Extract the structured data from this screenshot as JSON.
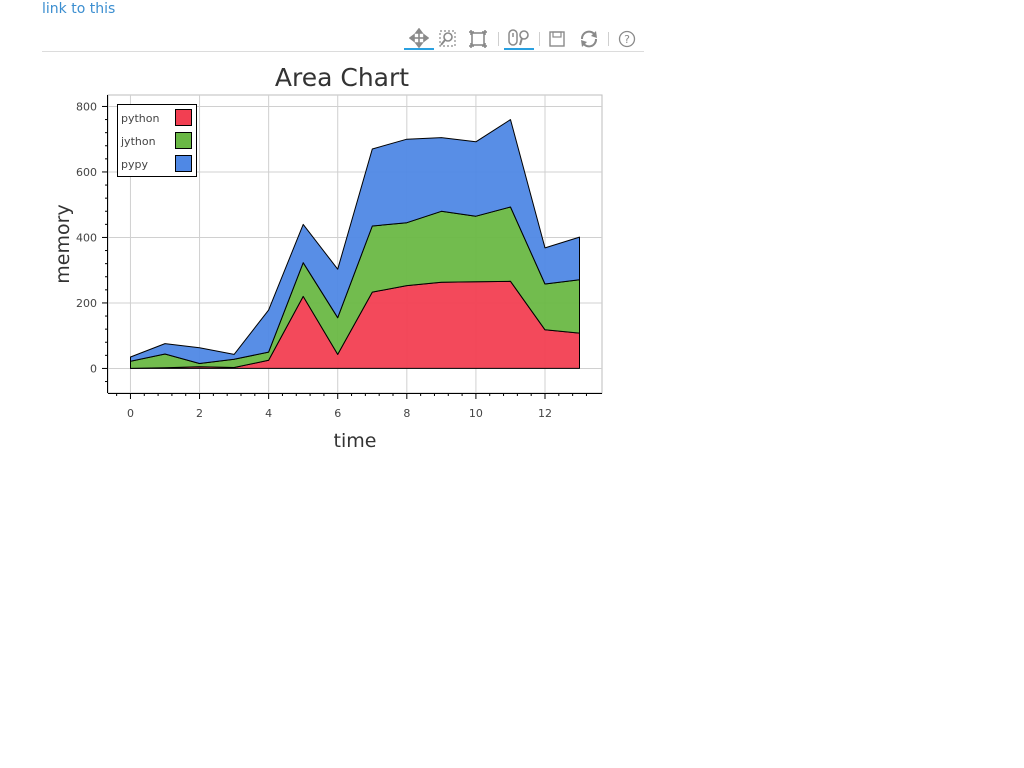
{
  "link": {
    "label": "link to this"
  },
  "toolbar": {
    "tools": [
      {
        "name": "pan-tool",
        "icon": "pan-icon",
        "active": true
      },
      {
        "name": "box-zoom-tool",
        "icon": "box-zoom-icon",
        "active": false
      },
      {
        "name": "resize-tool",
        "icon": "resize-icon",
        "active": false
      },
      {
        "name": "wheel-zoom-tool",
        "icon": "wheel-zoom-icon",
        "active": true
      },
      {
        "name": "save-tool",
        "icon": "save-icon",
        "active": false
      },
      {
        "name": "reset-tool",
        "icon": "reset-icon",
        "active": false
      },
      {
        "name": "help-tool",
        "icon": "help-icon",
        "active": false
      }
    ],
    "accent": "#2aa0e0"
  },
  "chart_data": {
    "type": "area",
    "stacked": true,
    "title": "Area Chart",
    "xlabel": "time",
    "ylabel": "memory",
    "x": [
      0,
      1,
      2,
      3,
      4,
      5,
      6,
      7,
      8,
      9,
      10,
      11,
      12,
      13
    ],
    "xlim": [
      -0.65,
      13.65
    ],
    "ylim": [
      -75,
      835
    ],
    "xticks": [
      0,
      2,
      4,
      6,
      8,
      10,
      12
    ],
    "yticks": [
      0,
      200,
      400,
      600,
      800
    ],
    "grid": true,
    "legend_position": "top-left",
    "series": [
      {
        "name": "python",
        "color": "#f23f52",
        "values": [
          0,
          2,
          5,
          3,
          25,
          220,
          43,
          233,
          253,
          263,
          265,
          266,
          118,
          108
        ]
      },
      {
        "name": "jython",
        "color": "#6ab845",
        "values": [
          22,
          42,
          10,
          25,
          25,
          103,
          112,
          202,
          192,
          217,
          200,
          227,
          140,
          163
        ]
      },
      {
        "name": "pypy",
        "color": "#4f88e5",
        "values": [
          13,
          32,
          48,
          15,
          128,
          117,
          148,
          235,
          255,
          225,
          227,
          267,
          110,
          130
        ]
      }
    ]
  }
}
